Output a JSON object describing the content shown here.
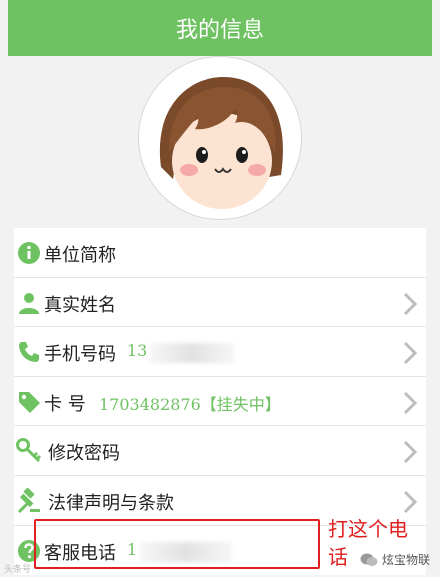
{
  "header": {
    "title": "我的信息"
  },
  "rows": [
    {
      "label": "单位简称",
      "value": "",
      "icon": "info-icon"
    },
    {
      "label": "真实姓名",
      "value": "",
      "icon": "person-icon"
    },
    {
      "label": "手机号码",
      "value": "13",
      "icon": "phone-icon"
    },
    {
      "label": "卡 号",
      "value": "1703482876【挂失中】",
      "icon": "tag-icon"
    },
    {
      "label": "修改密码",
      "value": "",
      "icon": "key-icon"
    },
    {
      "label": "法律声明与条款",
      "value": "",
      "icon": "gavel-icon"
    },
    {
      "label": "客服电话",
      "value": "1",
      "icon": "question-icon"
    }
  ],
  "annotation": {
    "text": "打这个电话"
  },
  "watermark": {
    "left": "头条号",
    "right": "炫宝物联"
  },
  "colors": {
    "header": "#6fc262",
    "accent": "#6fc262",
    "annotation": "#e02020"
  }
}
